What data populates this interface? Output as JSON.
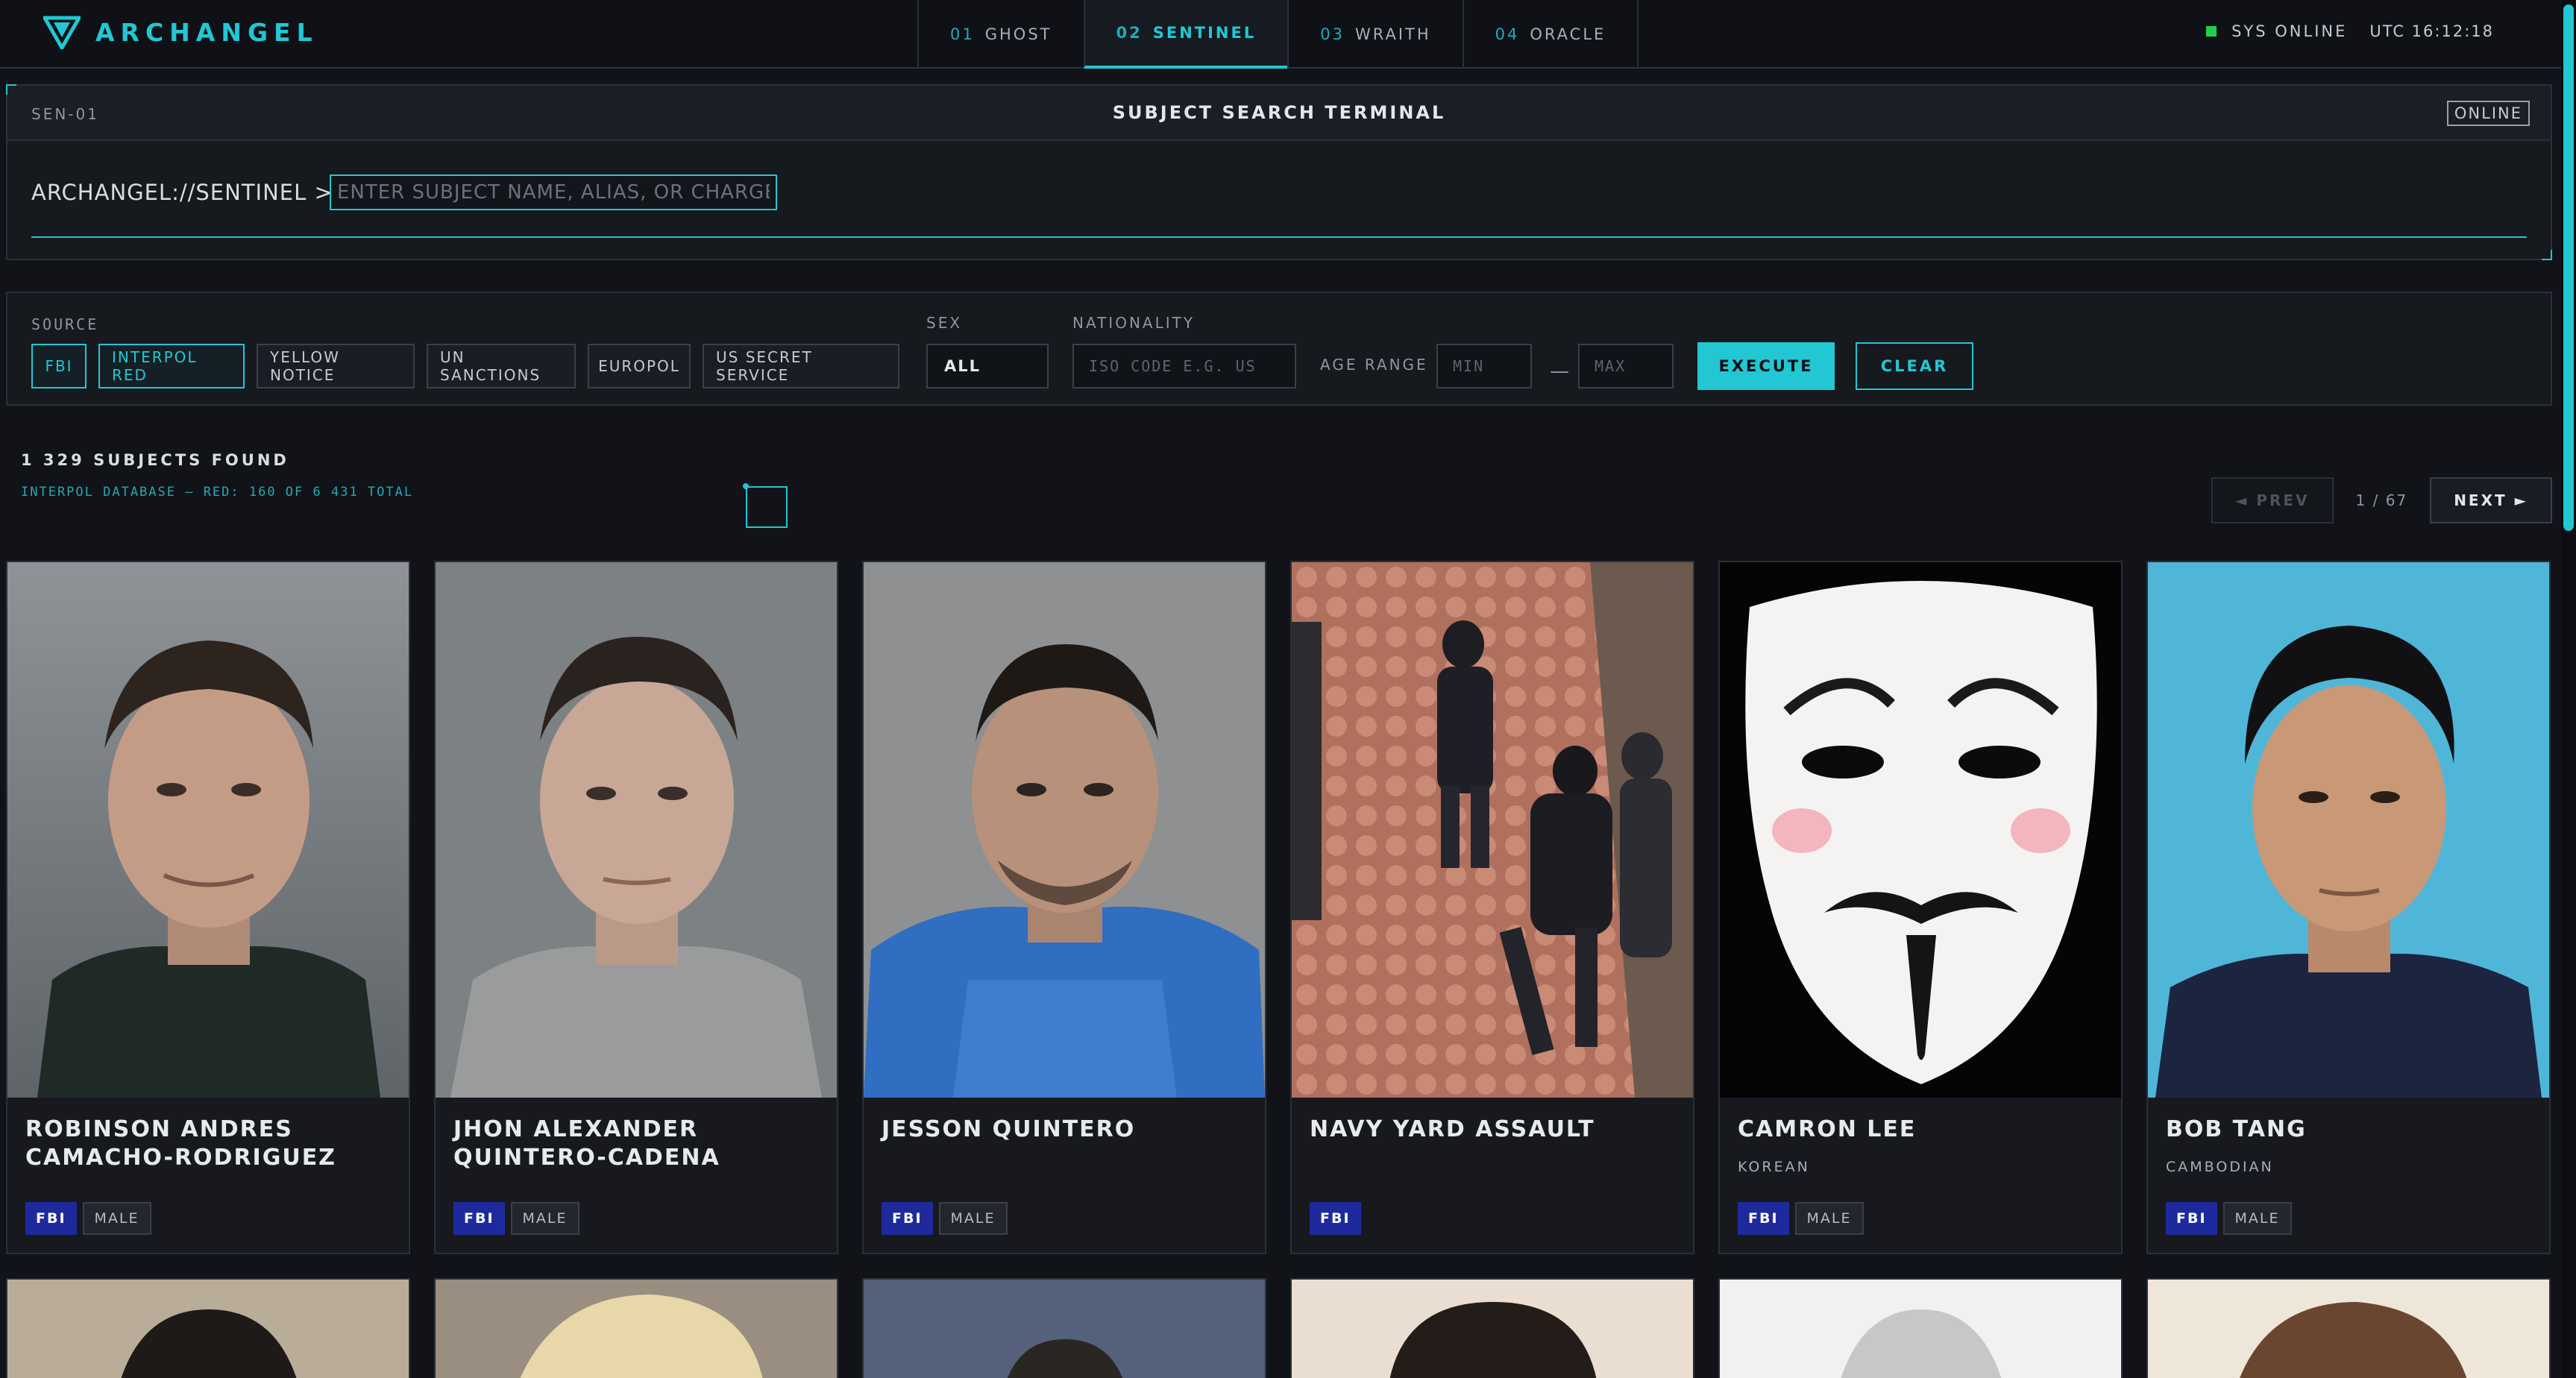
{
  "app": {
    "name": "ARCHANGEL"
  },
  "nav": {
    "tabs": [
      {
        "num": "01",
        "label": "GHOST"
      },
      {
        "num": "02",
        "label": "SENTINEL"
      },
      {
        "num": "03",
        "label": "WRAITH"
      },
      {
        "num": "04",
        "label": "ORACLE"
      }
    ],
    "active_tab": "SENTINEL"
  },
  "status": {
    "label": "SYS ONLINE",
    "clock": "UTC 16:12:18",
    "color": "#1fd14a"
  },
  "terminal": {
    "id": "SEN-01",
    "title": "SUBJECT SEARCH TERMINAL",
    "badge": "ONLINE",
    "prompt": "ARCHANGEL://SENTINEL >",
    "placeholder": "ENTER SUBJECT NAME, ALIAS, OR CHARGE...",
    "value": ""
  },
  "filters": {
    "source_label": "SOURCE",
    "sources": [
      {
        "label": "FBI",
        "active": true
      },
      {
        "label": "INTERPOL RED",
        "active": true
      },
      {
        "label": "YELLOW NOTICE",
        "active": false
      },
      {
        "label": "UN SANCTIONS",
        "active": false
      },
      {
        "label": "EUROPOL",
        "active": false
      },
      {
        "label": "US SECRET SERVICE",
        "active": false
      }
    ],
    "sex_label": "SEX",
    "sex_value": "ALL",
    "nationality_label": "NATIONALITY",
    "nationality_placeholder": "ISO CODE E.G. US",
    "age_label": "AGE RANGE",
    "age_min_placeholder": "MIN",
    "age_max_placeholder": "MAX",
    "execute_label": "EXECUTE",
    "clear_label": "CLEAR"
  },
  "results": {
    "count_text": "1 329 SUBJECTS FOUND",
    "db_note": "INTERPOL DATABASE — RED: 160 OF 6 431 TOTAL",
    "prev_label": "◄ PREV",
    "next_label": "NEXT ►",
    "page_text": "1 / 67"
  },
  "cards": [
    {
      "name": "ROBINSON ANDRES CAMACHO-RODRIGUEZ",
      "nationality": "",
      "tags": [
        "FBI",
        "MALE"
      ],
      "photo": "mugshot-photo"
    },
    {
      "name": "JHON ALEXANDER QUINTERO-CADENA",
      "nationality": "",
      "tags": [
        "FBI",
        "MALE"
      ],
      "photo": "mugshot-photo"
    },
    {
      "name": "JESSON QUINTERO",
      "nationality": "",
      "tags": [
        "FBI",
        "MALE"
      ],
      "photo": "mugshot-photo"
    },
    {
      "name": "NAVY YARD ASSAULT",
      "nationality": "",
      "tags": [
        "FBI"
      ],
      "photo": "surveillance-photo"
    },
    {
      "name": "CAMRON LEE",
      "nationality": "KOREAN",
      "tags": [
        "FBI",
        "MALE"
      ],
      "photo": "mask-photo"
    },
    {
      "name": "BOB TANG",
      "nationality": "CAMBODIAN",
      "tags": [
        "FBI",
        "MALE"
      ],
      "photo": "portrait-photo"
    }
  ],
  "colors": {
    "accent": "#22c7d3",
    "fbi_tag": "#1e2a9c",
    "background": "#111318"
  }
}
